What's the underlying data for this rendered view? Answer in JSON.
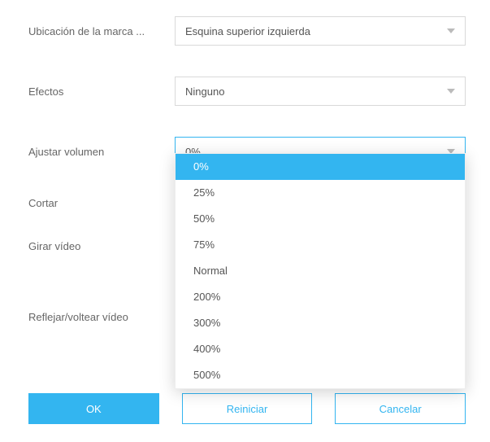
{
  "fields": {
    "watermark_position": {
      "label": "Ubicación de la marca ...",
      "value": "Esquina superior izquierda"
    },
    "effects": {
      "label": "Efectos",
      "value": "Ninguno"
    },
    "volume": {
      "label": "Ajustar volumen",
      "value": "0%",
      "options": [
        "0%",
        "25%",
        "50%",
        "75%",
        "Normal",
        "200%",
        "300%",
        "400%",
        "500%"
      ],
      "selected_index": 0
    },
    "crop": {
      "label": "Cortar"
    },
    "rotate": {
      "label": "Girar vídeo"
    },
    "flip": {
      "label": "Reflejar/voltear vídeo"
    }
  },
  "buttons": {
    "ok": "OK",
    "reset": "Reiniciar",
    "cancel": "Cancelar"
  }
}
